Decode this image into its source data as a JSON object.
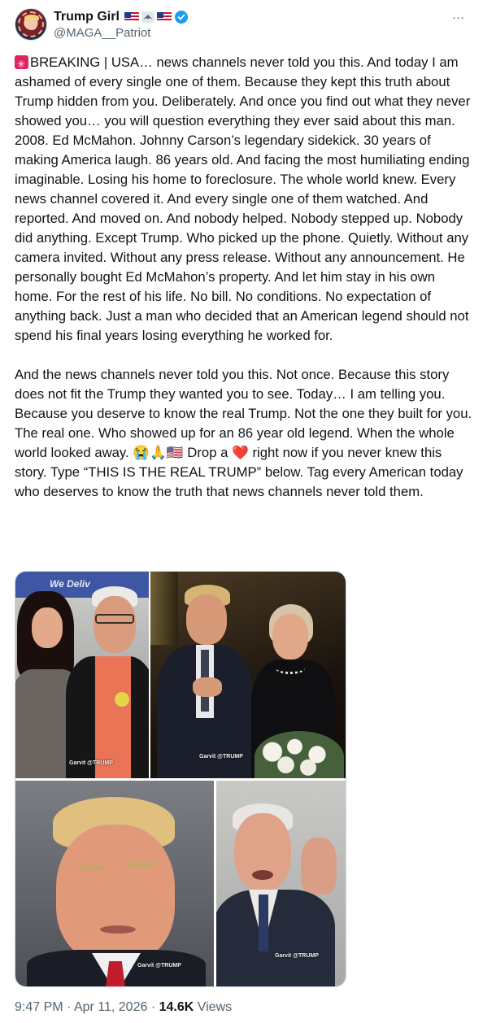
{
  "post": {
    "display_name": "Trump Girl",
    "handle": "@MAGA__Patriot",
    "more_icon": "…",
    "text_p1": "BREAKING | USA… news channels never told you this. And today I am ashamed of every single one of them. Because they kept this truth about Trump hidden from you. Deliberately. And once you find out what they never showed you… you will question everything they ever said about this man. 2008. Ed McMahon. Johnny Carson’s legendary sidekick. 30 years of making America laugh. 86 years old. And facing the most humiliating ending imaginable. Losing his home to foreclosure. The whole world knew. Every news channel covered it. And every single one of them watched. And reported. And moved on. And nobody helped. Nobody stepped up. Nobody did anything. Except Trump. Who picked up the phone. Quietly. Without any camera invited. Without any press release. Without any announcement. He personally bought Ed McMahon’s property. And let him stay in his own home. For the rest of his life. No bill. No conditions. No expectation of anything back. Just a man who decided that an American legend should not spend his final years losing everything he worked for.",
    "text_p2a": "And the news channels never told you this. Not once. Because this story does not fit the Trump they wanted you to see. Today… I am telling you. Because you deserve to know the real Trump. Not the one they built for you. The real one. Who showed up for an 86 year old legend. When the whole world looked away.",
    "text_emoji": "😭🙏🇺🇸",
    "text_p2b": " Drop a ",
    "text_heart": "❤️",
    "text_p2c": " right now if you never knew this story. Type “THIS IS THE REAL TRUMP” below. Tag every American today who deserves to know the truth that news channels never told them."
  },
  "media": {
    "photo1_banner": "We Deliv",
    "photo1_caption": "Garvit @TRUMP",
    "photo2_caption": "Garvit @TRUMP",
    "photo3_caption": "Garvit @TRUMP",
    "photo4_caption": "Garvit @TRUMP"
  },
  "meta": {
    "time": "9:47 PM",
    "sep1": " · ",
    "date": "Apr 11, 2026",
    "sep2": " · ",
    "views_count": "14.6K",
    "views_label": " Views"
  },
  "colors": {
    "text": "#0f1419",
    "secondary": "#536471",
    "verified": "#1d9bf0"
  },
  "icons": [
    "avatar",
    "us-flag-icon",
    "eagle-mountain-icon",
    "verified-badge-icon",
    "more-options-icon",
    "siren-icon"
  ]
}
